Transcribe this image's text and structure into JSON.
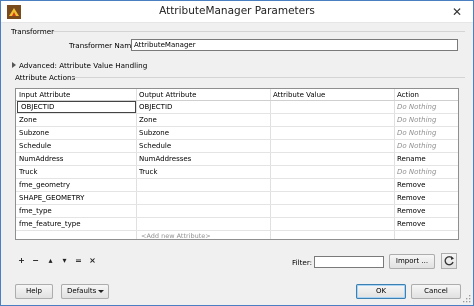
{
  "window": {
    "title": "AttributeManager Parameters"
  },
  "transformer": {
    "section_label": "Transformer",
    "name_label": "Transformer Name:",
    "name_value": "AttributeManager"
  },
  "advanced": {
    "label": "Advanced: Attribute Value Handling"
  },
  "attribute_actions": {
    "section_label": "Attribute Actions",
    "columns": [
      "Input Attribute",
      "Output Attribute",
      "Attribute Value",
      "Action"
    ],
    "rows": [
      {
        "input": "OBJECTID",
        "output": "OBJECTID",
        "value": "",
        "action": "Do Nothing"
      },
      {
        "input": "Zone",
        "output": "Zone",
        "value": "",
        "action": "Do Nothing"
      },
      {
        "input": "Subzone",
        "output": "Subzone",
        "value": "",
        "action": "Do Nothing"
      },
      {
        "input": "Schedule",
        "output": "Schedule",
        "value": "",
        "action": "Do Nothing"
      },
      {
        "input": "NumAddress",
        "output": "NumAddresses",
        "value": "",
        "action": "Rename"
      },
      {
        "input": "Truck",
        "output": "Truck",
        "value": "",
        "action": "Do Nothing"
      },
      {
        "input": "fme_geometry",
        "output": "",
        "value": "",
        "action": "Remove"
      },
      {
        "input": "SHAPE_GEOMETRY",
        "output": "",
        "value": "",
        "action": "Remove"
      },
      {
        "input": "fme_type",
        "output": "",
        "value": "",
        "action": "Remove"
      },
      {
        "input": "fme_feature_type",
        "output": "",
        "value": "",
        "action": "Remove"
      }
    ],
    "add_new_placeholder": "<Add new Attribute>"
  },
  "toolbar": {
    "add_symbol": "+",
    "remove_symbol": "−",
    "move_up_symbol": "▴",
    "move_down_symbol": "▾",
    "duplicate_symbol": "=",
    "clear_symbol": "×",
    "filter_label": "Filter:",
    "filter_value": "",
    "import_label": "Import ...",
    "refresh_icon": "refresh-icon"
  },
  "footer": {
    "help_label": "Help",
    "defaults_label": "Defaults",
    "ok_label": "OK",
    "cancel_label": "Cancel"
  },
  "colors": {
    "window_border": "#4a7fc1",
    "muted_text": "#909090"
  }
}
